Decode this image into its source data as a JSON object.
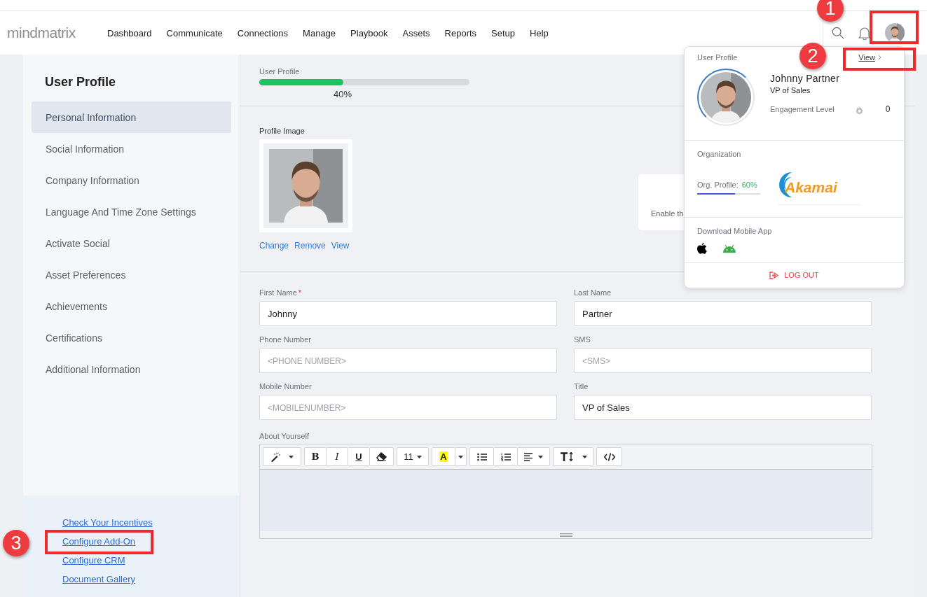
{
  "header": {
    "logo": "mindmatrix",
    "nav": [
      {
        "label": "Dashboard"
      },
      {
        "label": "Communicate"
      },
      {
        "label": "Connections"
      },
      {
        "label": "Manage"
      },
      {
        "label": "Playbook"
      },
      {
        "label": "Assets"
      },
      {
        "label": "Reports"
      },
      {
        "label": "Setup"
      },
      {
        "label": "Help"
      }
    ]
  },
  "sidebar": {
    "title": "User Profile",
    "items": [
      {
        "label": "Personal Information",
        "selected": true
      },
      {
        "label": "Social Information",
        "selected": false
      },
      {
        "label": "Company Information",
        "selected": false
      },
      {
        "label": "Language And Time Zone Settings",
        "selected": false
      },
      {
        "label": "Activate Social",
        "selected": false
      },
      {
        "label": "Asset Preferences",
        "selected": false
      },
      {
        "label": "Achievements",
        "selected": false
      },
      {
        "label": "Certifications",
        "selected": false
      },
      {
        "label": "Additional Information",
        "selected": false
      }
    ],
    "links": [
      "Check Your Incentives",
      "Configure Add-On",
      "Configure CRM",
      "Document Gallery"
    ]
  },
  "progress": {
    "label": "User Profile",
    "level": 0.4,
    "reading": "40%"
  },
  "profile_image": {
    "label": "Profile Image",
    "actions": [
      "Change",
      "Remove",
      "View"
    ]
  },
  "side_card": {
    "text": "Enable th"
  },
  "fields": [
    {
      "label": "First Name",
      "required_mark": "*",
      "value": "Johnny"
    },
    {
      "label": "Last Name",
      "value": "Partner"
    },
    {
      "label": "Phone Number",
      "placeholder": "<PHONE NUMBER>"
    },
    {
      "label": "SMS",
      "placeholder": "<SMS>"
    },
    {
      "label": "Mobile Number",
      "placeholder": "<MOBILENUMBER>"
    },
    {
      "label": "Title",
      "value": "VP of Sales"
    }
  ],
  "about": {
    "label": "About Yourself",
    "toolbar": [
      [
        {
          "kind": "wand"
        }
      ],
      [
        {
          "kind": "bold",
          "label": "B"
        },
        {
          "kind": "italic",
          "label": "I"
        },
        {
          "kind": "underline",
          "label": "U"
        },
        {
          "kind": "eraser"
        }
      ],
      [
        {
          "kind": "size",
          "label": "11"
        }
      ],
      [
        {
          "kind": "color",
          "label": "A"
        },
        {
          "kind": "caret"
        }
      ],
      [
        {
          "kind": "ul"
        },
        {
          "kind": "ol"
        },
        {
          "kind": "align"
        }
      ],
      [
        {
          "kind": "height"
        }
      ],
      [
        {
          "kind": "code"
        }
      ]
    ]
  },
  "popup": {
    "title": "User Profile",
    "view_link": "View",
    "name": "Johnny Partner",
    "role": "VP of Sales",
    "engagement_label": "Engagement Level",
    "engagement_value": "0",
    "org_title": "Organization",
    "org_profile": {
      "label": "Org. Profile:",
      "level": 0.6,
      "reading": "60%"
    },
    "org_logo": "Akamai",
    "app_title": "Download Mobile App",
    "logout": "LOG OUT"
  },
  "callouts": [
    {
      "number": "1"
    },
    {
      "number": "2"
    },
    {
      "number": "3"
    }
  ]
}
